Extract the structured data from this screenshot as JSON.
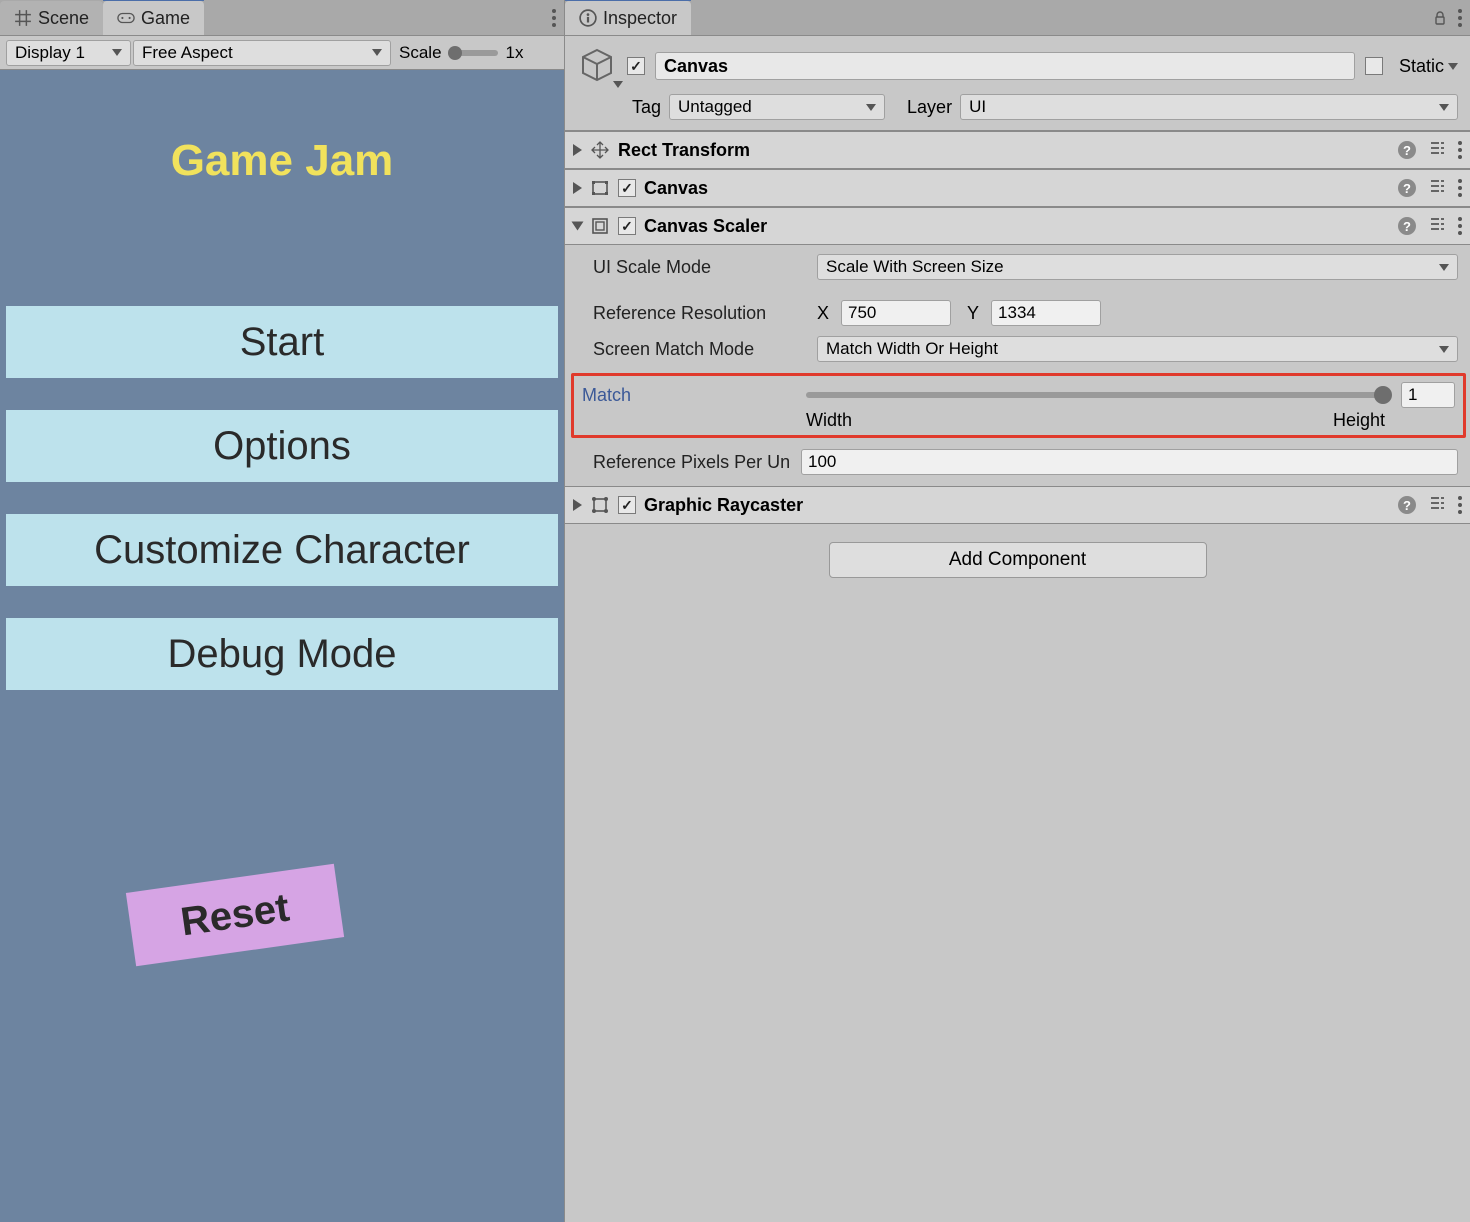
{
  "left": {
    "tabs": {
      "scene": "Scene",
      "game": "Game"
    },
    "toolbar": {
      "display": "Display 1",
      "aspect": "Free Aspect",
      "scale_label": "Scale",
      "scale_value": "1x"
    },
    "game": {
      "title": "Game Jam",
      "buttons": [
        "Start",
        "Options",
        "Customize Character",
        "Debug Mode"
      ],
      "reset": "Reset"
    }
  },
  "right": {
    "tab": "Inspector",
    "object": {
      "name": "Canvas",
      "static": "Static",
      "tag_label": "Tag",
      "tag_value": "Untagged",
      "layer_label": "Layer",
      "layer_value": "UI"
    },
    "components": {
      "rect": "Rect Transform",
      "canvas": "Canvas",
      "scaler": {
        "title": "Canvas Scaler",
        "mode_label": "UI Scale Mode",
        "mode_value": "Scale With Screen Size",
        "refres_label": "Reference Resolution",
        "x_label": "X",
        "x_value": "750",
        "y_label": "Y",
        "y_value": "1334",
        "matchmode_label": "Screen Match Mode",
        "matchmode_value": "Match Width Or Height",
        "match_label": "Match",
        "match_value": "1",
        "width_label": "Width",
        "height_label": "Height",
        "ppu_label": "Reference Pixels Per Un",
        "ppu_value": "100"
      },
      "raycaster": "Graphic Raycaster"
    },
    "add_component": "Add Component"
  }
}
